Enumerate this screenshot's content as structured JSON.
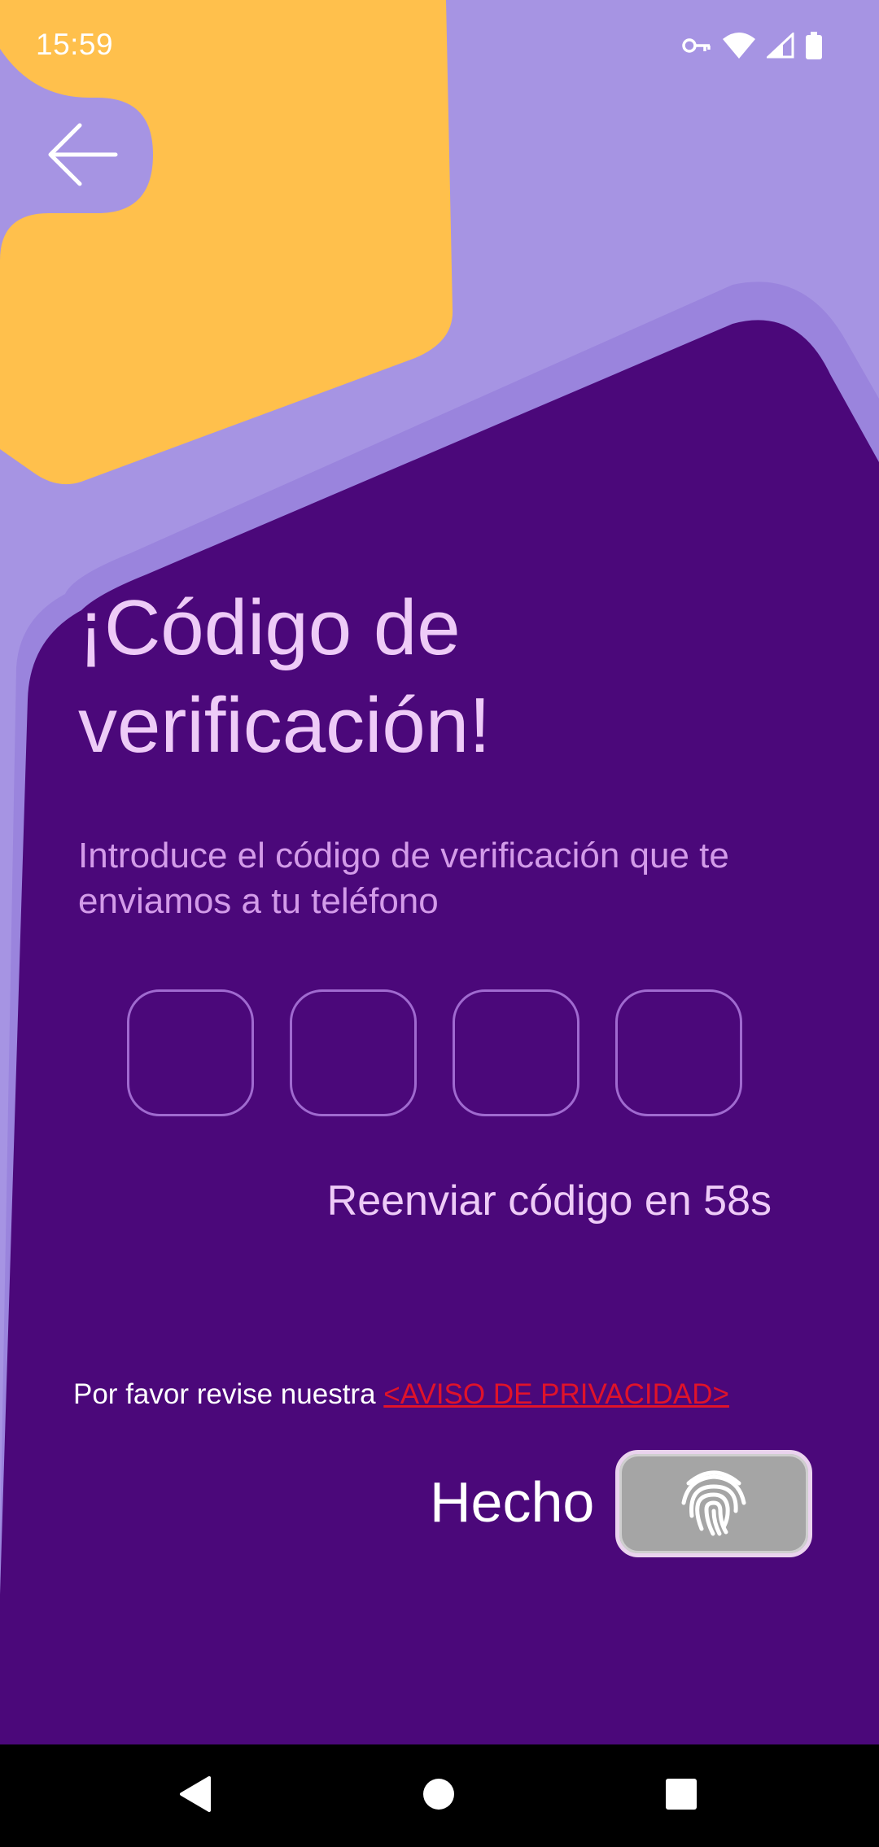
{
  "status_bar": {
    "time": "15:59",
    "icons": [
      "vpn-key-icon",
      "wifi-icon",
      "signal-icon",
      "battery-icon"
    ]
  },
  "header": {
    "back_icon": "arrow-left-icon"
  },
  "main": {
    "title": "¡Código de verificación!",
    "subtitle": "Introduce el código de verificación que te enviamos a tu teléfono",
    "code_digits": [
      "",
      "",
      "",
      ""
    ],
    "resend_text": "Reenviar código en 58s",
    "privacy_text": "Por favor revise nuestra ",
    "privacy_link": "<AVISO DE PRIVACIDAD>",
    "done_label": "Hecho",
    "fingerprint_icon": "fingerprint-icon"
  },
  "nav_bar": {
    "icons": [
      "back-triangle-icon",
      "home-circle-icon",
      "recents-square-icon"
    ]
  },
  "colors": {
    "background_light_purple": "#a694e3",
    "panel_dark_purple": "#4b087a",
    "accent_yellow": "#ffc04c",
    "title_pink": "#eecbf7",
    "subtitle_purple": "#d39be9",
    "link_red": "#e0132a"
  }
}
